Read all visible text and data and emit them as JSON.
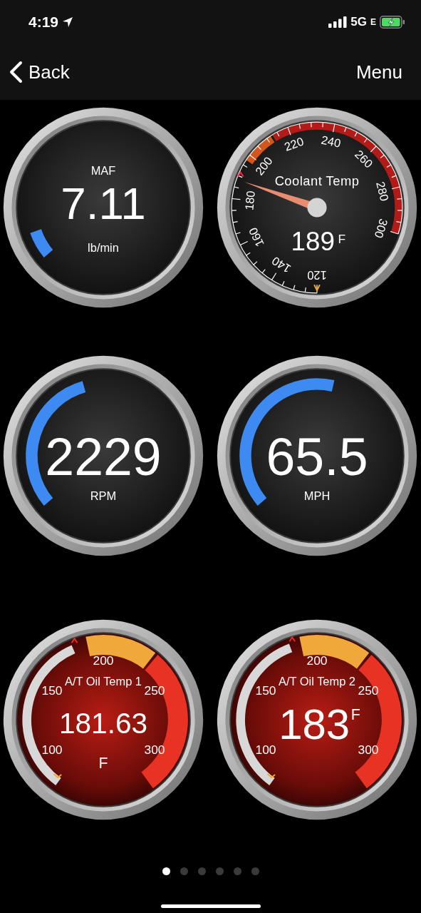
{
  "status_bar": {
    "time": "4:19",
    "network": "5G",
    "network_suffix": "E"
  },
  "nav": {
    "back": "Back",
    "menu": "Menu"
  },
  "gauges": [
    {
      "kind": "arc",
      "title": "MAF",
      "value": "7.11",
      "unit": "lb/min"
    },
    {
      "kind": "dial",
      "title": "Coolant Temp",
      "value": "189",
      "unit": "F",
      "ticks": [
        "120",
        "140",
        "160",
        "180",
        "200",
        "220",
        "240",
        "260",
        "280",
        "300"
      ]
    },
    {
      "kind": "arc",
      "value": "2229",
      "unit": "RPM"
    },
    {
      "kind": "arc",
      "value": "65.5",
      "unit": "MPH"
    },
    {
      "kind": "band",
      "title": "A/T Oil Temp 1",
      "value": "181.63",
      "unit": "F",
      "ticks": [
        "100",
        "150",
        "200",
        "250",
        "300"
      ]
    },
    {
      "kind": "band",
      "title": "A/T Oil Temp 2",
      "value": "183",
      "unit": "F",
      "ticks": [
        "100",
        "150",
        "200",
        "250",
        "300"
      ]
    }
  ],
  "page_dots": [
    {
      "selected": true
    },
    {
      "selected": false
    },
    {
      "selected": false
    },
    {
      "selected": false
    },
    {
      "selected": false
    },
    {
      "selected": false
    }
  ]
}
